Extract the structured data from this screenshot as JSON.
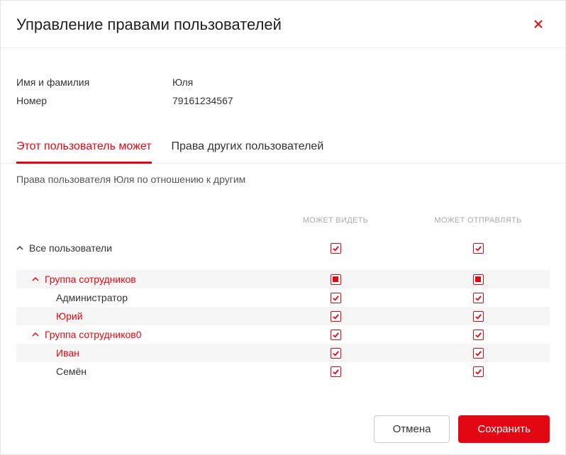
{
  "header": {
    "title": "Управление правами пользователей"
  },
  "info": {
    "name_label": "Имя и фамилия",
    "name_value": "Юля",
    "number_label": "Номер",
    "number_value": "79161234567"
  },
  "tabs": {
    "tab_self": "Этот пользователь может",
    "tab_others": "Права других пользователей"
  },
  "subtitle": "Права пользователя Юля по отношению к другим",
  "columns": {
    "can_see": "МОЖЕТ ВИДЕТЬ",
    "can_send": "МОЖЕТ ОТПРАВЛЯТЬ"
  },
  "rows": {
    "all_users": "Все пользователи",
    "group0": "Группа сотрудников",
    "admin": "Администратор",
    "yuri": "Юрий",
    "group1": "Группа сотрудников0",
    "ivan": "Иван",
    "semen": "Семён"
  },
  "buttons": {
    "cancel": "Отмена",
    "save": "Сохранить"
  }
}
